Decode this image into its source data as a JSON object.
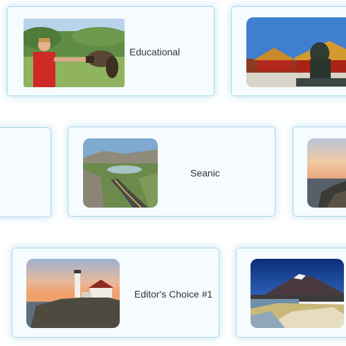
{
  "cards": [
    {
      "label": "Educational",
      "image": "falconer-boy-photo"
    },
    {
      "label": "",
      "image": "forbidden-city-lion-photo"
    },
    {
      "label": "",
      "image": ""
    },
    {
      "label": "Seanic",
      "image": "winding-road-photo"
    },
    {
      "label": "",
      "image": "coastal-rocks-sunset-photo"
    },
    {
      "label": "Editor's Choice #1",
      "image": "lighthouse-sunset-photo"
    },
    {
      "label": "",
      "image": "volcano-lake-photo"
    }
  ]
}
